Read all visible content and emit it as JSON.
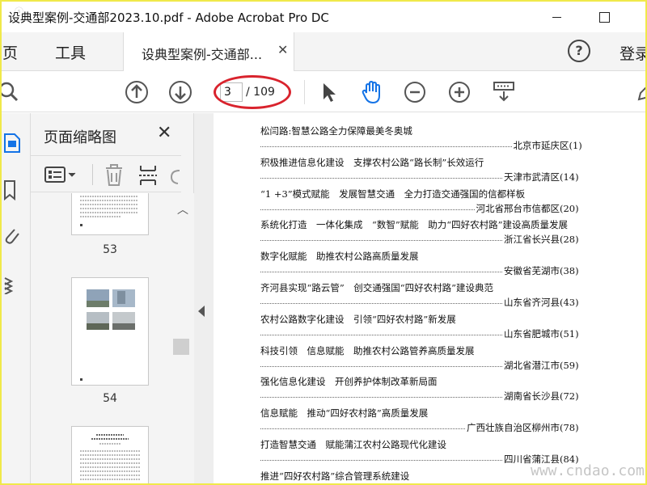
{
  "window": {
    "title": "设典型案例-交通部2023.10.pdf - Adobe Acrobat Pro DC"
  },
  "tabs": {
    "home": "主页",
    "tools": "工具",
    "document": "设典型案例-交通部...",
    "signin": "登录"
  },
  "toolbar": {
    "current_page": "3",
    "total_pages": "/ 109"
  },
  "thumbnail_panel": {
    "title": "页面缩略图",
    "thumbnails": [
      {
        "page": "53"
      },
      {
        "page": "54"
      }
    ]
  },
  "toc": [
    {
      "title": "松闫路:智慧公路全力保障最美冬奥城",
      "place": "北京市延庆区(1)"
    },
    {
      "title": "积极推进信息化建设　支撑农村公路“路长制”长效运行",
      "place": "天津市武清区(14)"
    },
    {
      "title": "“1 +3”模式赋能　发展智慧交通　全力打造交通强国的信都样板",
      "place": "河北省邢台市信都区(20)"
    },
    {
      "title": "系统化打造　一体化集成　“数智”赋能　助力“四好农村路”建设高质量发展",
      "place": "浙江省长兴县(28)"
    },
    {
      "title": "数字化赋能　助推农村公路高质量发展",
      "place": "安徽省芜湖市(38)"
    },
    {
      "title": "齐河县实现“路云管”　创交通强国“四好农村路”建设典范",
      "place": "山东省齐河县(43)"
    },
    {
      "title": "农村公路数字化建设　引领“四好农村路”新发展",
      "place": "山东省肥城市(51)"
    },
    {
      "title": "科技引领　信息赋能　助推农村公路管养高质量发展",
      "place": "湖北省潜江市(59)"
    },
    {
      "title": "强化信息化建设　开创养护体制改革新局面",
      "place": "湖南省长沙县(72)"
    },
    {
      "title": "信息赋能　推动“四好农村路”高质量发展",
      "place": "广西壮族自治区柳州市(78)"
    },
    {
      "title": "打造智慧交通　赋能蒲江农村公路现代化建设",
      "place": "四川省蒲江县(84)"
    },
    {
      "title": "推进“四好农村路”综合管理系统建设",
      "place": ""
    }
  ],
  "watermark": "www.cndao.com",
  "colors": {
    "frame_border": "#f0e94a",
    "annotation_ellipse": "#d9232d",
    "acrobat_blue": "#1473e6"
  }
}
